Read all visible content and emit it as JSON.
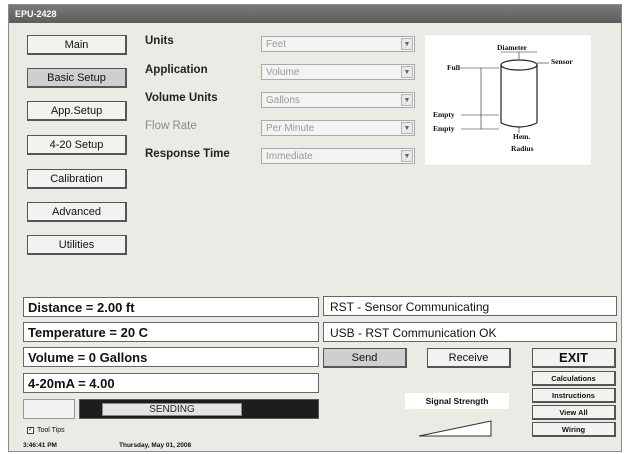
{
  "window": {
    "title": "EPU-2428"
  },
  "nav": [
    {
      "label": "Main",
      "selected": false
    },
    {
      "label": "Basic Setup",
      "selected": true
    },
    {
      "label": "App.Setup",
      "selected": false
    },
    {
      "label": "4-20 Setup",
      "selected": false
    },
    {
      "label": "Calibration",
      "selected": false
    },
    {
      "label": "Advanced",
      "selected": false
    },
    {
      "label": "Utilities",
      "selected": false
    }
  ],
  "fields": [
    {
      "label": "Units",
      "value": "Feet",
      "enabled": true
    },
    {
      "label": "Application",
      "value": "Volume",
      "enabled": true
    },
    {
      "label": "Volume Units",
      "value": "Gallons",
      "enabled": true
    },
    {
      "label": "Flow Rate",
      "value": "Per Minute",
      "enabled": false
    },
    {
      "label": "Response Time",
      "value": "Immediate",
      "enabled": true
    }
  ],
  "diagram": {
    "diameter": "Diameter",
    "sensor": "Sensor",
    "full": "Full",
    "empty": "Empty",
    "empty2": "Empty",
    "hem": "Hem.",
    "radius": "Radius"
  },
  "readouts": {
    "distance": "Distance = 2.00 ft",
    "temperature": "Temperature = 20 C",
    "volume": "Volume = 0 Gallons",
    "current": "4-20mA = 4.00"
  },
  "status": {
    "sensor": "RST - Sensor Communicating",
    "usb": "USB - RST Communication OK"
  },
  "actions": {
    "send": "Send",
    "receive": "Receive",
    "exit": "EXIT"
  },
  "side_buttons": [
    "Calculations",
    "Instructions",
    "View All",
    "Wiring"
  ],
  "progress": {
    "label": "SENDING"
  },
  "signal": {
    "label": "Signal Strength"
  },
  "tooltips": {
    "label": "Tool Tips",
    "checked": true
  },
  "footer": {
    "time": "3:46:41 PM",
    "date": "Thursday, May 01, 2008"
  }
}
